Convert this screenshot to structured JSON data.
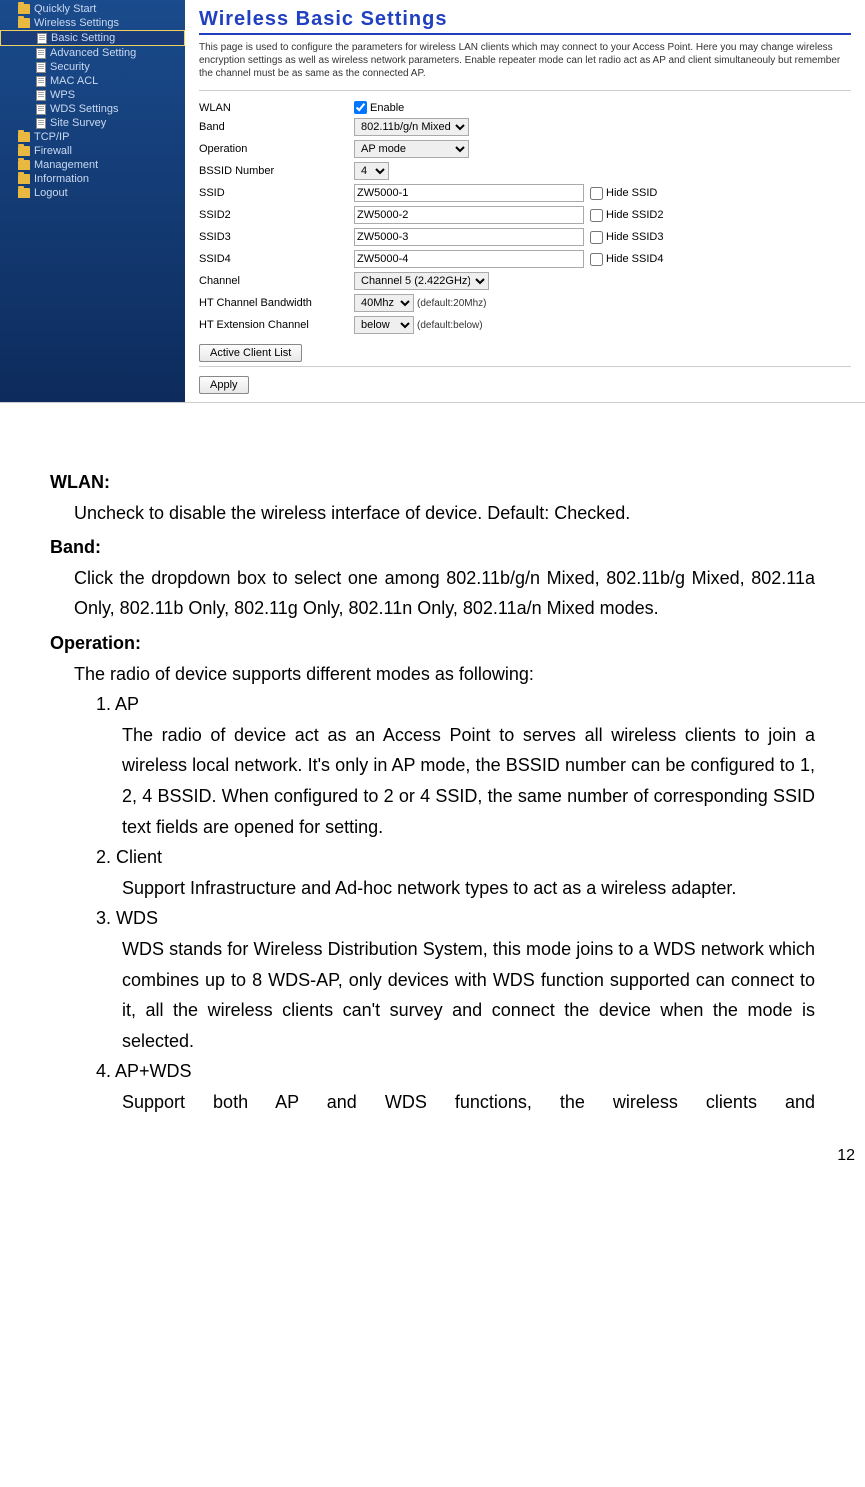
{
  "sidebar": {
    "items": [
      {
        "label": "Quickly Start",
        "type": "folder"
      },
      {
        "label": "Wireless Settings",
        "type": "folder"
      },
      {
        "label": "Basic Setting",
        "type": "doc",
        "nested": true,
        "selected": true
      },
      {
        "label": "Advanced Setting",
        "type": "doc",
        "nested": true
      },
      {
        "label": "Security",
        "type": "doc",
        "nested": true
      },
      {
        "label": "MAC ACL",
        "type": "doc",
        "nested": true
      },
      {
        "label": "WPS",
        "type": "doc",
        "nested": true
      },
      {
        "label": "WDS Settings",
        "type": "doc",
        "nested": true
      },
      {
        "label": "Site Survey",
        "type": "doc",
        "nested": true
      },
      {
        "label": "TCP/IP",
        "type": "folder"
      },
      {
        "label": "Firewall",
        "type": "folder"
      },
      {
        "label": "Management",
        "type": "folder"
      },
      {
        "label": "Information",
        "type": "folder"
      },
      {
        "label": "Logout",
        "type": "folder"
      }
    ]
  },
  "panel": {
    "title": "Wireless Basic Settings",
    "description": "This page is used to configure the parameters for wireless LAN clients which may connect to your Access Point. Here you may change wireless encryption settings as well as wireless network parameters. Enable repeater mode can let radio act as AP and client simultaneouly but remember the channel must be as same as the connected AP.",
    "form": {
      "wlan_label": "WLAN",
      "wlan_enable": "Enable",
      "band_label": "Band",
      "band_value": "802.11b/g/n Mixed",
      "operation_label": "Operation",
      "operation_value": "AP mode",
      "bssid_label": "BSSID Number",
      "bssid_value": "4",
      "ssid_label": "SSID",
      "ssid_value": "ZW5000-1",
      "hide_ssid": "Hide SSID",
      "ssid2_label": "SSID2",
      "ssid2_value": "ZW5000-2",
      "hide_ssid2": "Hide SSID2",
      "ssid3_label": "SSID3",
      "ssid3_value": "ZW5000-3",
      "hide_ssid3": "Hide SSID3",
      "ssid4_label": "SSID4",
      "ssid4_value": "ZW5000-4",
      "hide_ssid4": "Hide SSID4",
      "channel_label": "Channel",
      "channel_value": "Channel 5 (2.422GHz)",
      "htbw_label": "HT Channel Bandwidth",
      "htbw_value": "40Mhz",
      "htbw_default": "(default:20Mhz)",
      "htext_label": "HT Extension Channel",
      "htext_value": "below",
      "htext_default": "(default:below)",
      "btn_active": "Active Client List",
      "btn_apply": "Apply"
    }
  },
  "doc": {
    "wlan_term": "WLAN:",
    "wlan_desc": "Uncheck to disable the wireless interface of device. Default: Checked.",
    "band_term": "Band:",
    "band_desc": "Click the dropdown box to select one among 802.11b/g/n Mixed, 802.11b/g Mixed, 802.11a Only, 802.11b Only, 802.11g Only, 802.11n Only, 802.11a/n Mixed modes.",
    "op_term": "Operation:",
    "op_desc": "The radio of device supports different modes as following:",
    "item1": "1. AP",
    "item1_desc": "The radio of device act as an Access Point to serves all wireless clients to join a wireless local network. It's only in AP mode, the BSSID number can be configured to 1, 2, 4 BSSID. When configured to 2 or 4 SSID, the same number of corresponding SSID text fields are opened for setting.",
    "item2": "2. Client",
    "item2_desc": "Support Infrastructure and Ad-hoc network types to act as a wireless adapter.",
    "item3": "3. WDS",
    "item3_desc": "WDS stands for Wireless Distribution System, this mode joins to a WDS network which combines up to 8 WDS-AP, only devices with WDS function supported can connect to it, all the wireless clients can't survey and connect the device when the mode is selected.",
    "item4": "4. AP+WDS",
    "item4_desc": "Support both AP and WDS functions, the wireless clients and",
    "page_number": "12"
  }
}
